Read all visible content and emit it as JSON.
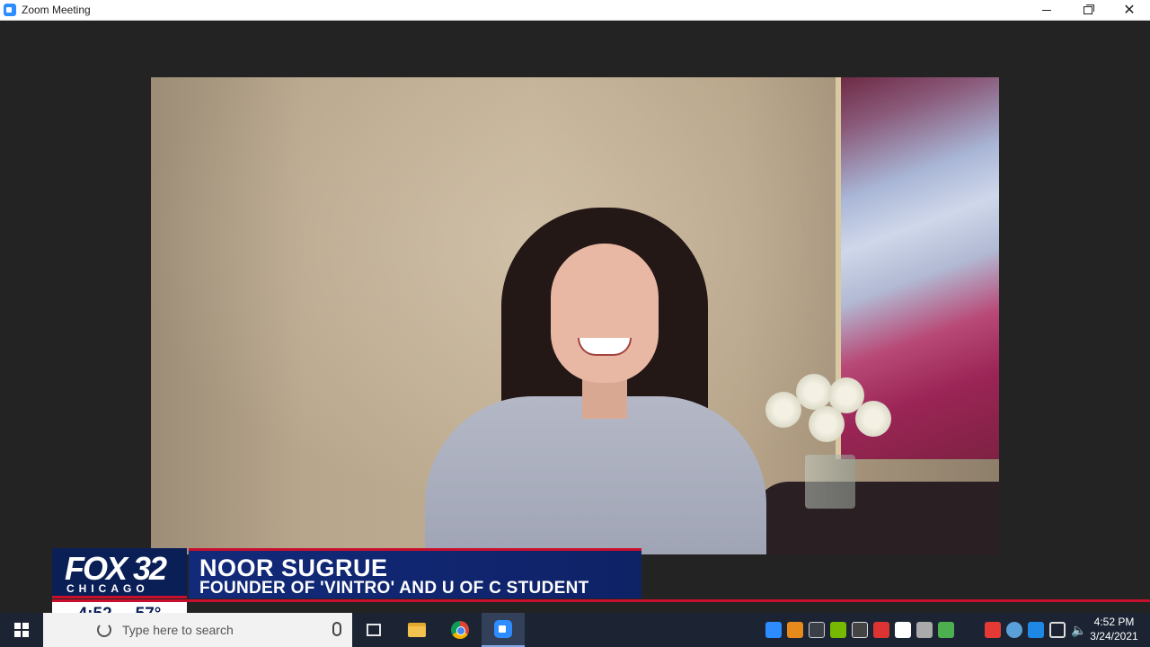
{
  "window": {
    "title": "Zoom Meeting",
    "controls": [
      "minimize",
      "maximize",
      "close"
    ]
  },
  "lower_third": {
    "brand_main": "FOX 32",
    "brand_sub": "CHICAGO",
    "name": "NOOR SUGRUE",
    "title": "FOUNDER OF 'VINTRO' AND U OF C STUDENT",
    "time": "4:52",
    "temperature": "57°"
  },
  "taskbar": {
    "search_placeholder": "Type here to search",
    "apps": [
      "task-view",
      "file-explorer",
      "chrome",
      "zoom"
    ],
    "tray_icons": [
      "zoom-tray",
      "tray-orange",
      "tray-monitor",
      "tray-nvidia",
      "tray-app",
      "tray-red",
      "tray-shield",
      "tray-cloud",
      "tray-green",
      "tray-red-2",
      "tray-globe",
      "tray-blue",
      "network",
      "volume"
    ],
    "clock_time": "4:52 PM",
    "clock_date": "3/24/2021"
  },
  "colors": {
    "fox_navy": "#0b1f57",
    "fox_red": "#c8102e",
    "zoom_blue": "#2d8cff"
  }
}
